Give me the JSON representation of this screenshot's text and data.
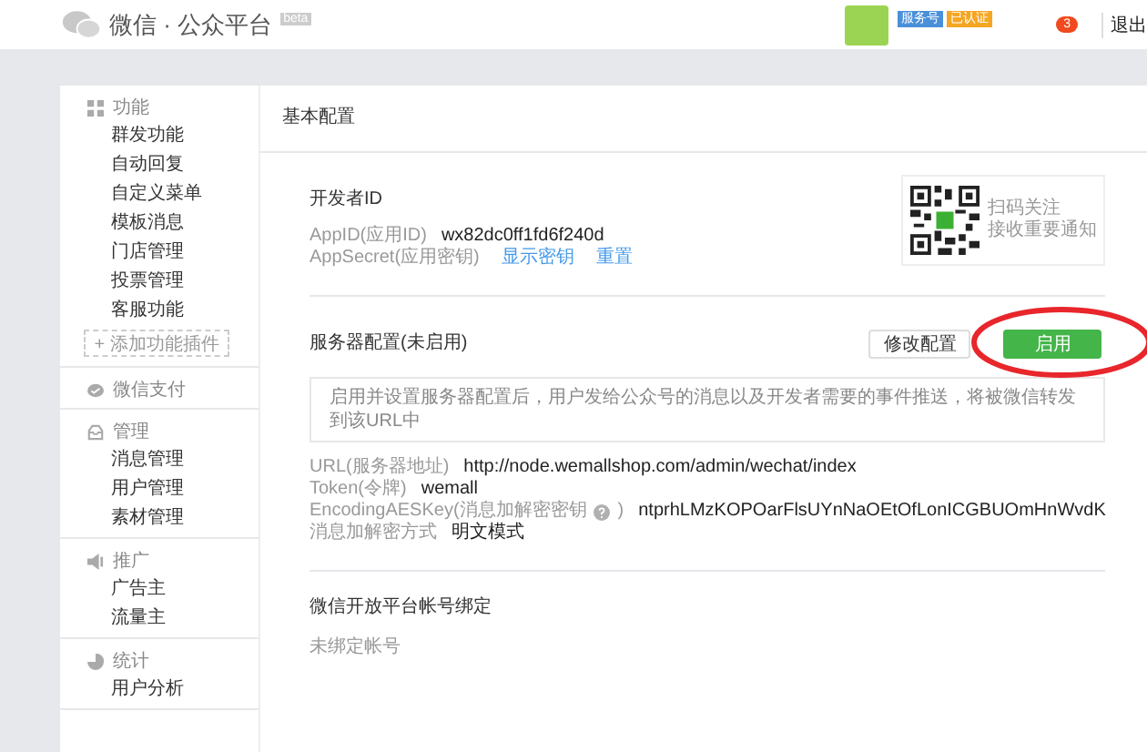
{
  "header": {
    "logo_text": "微信 · 公众平台",
    "beta": "beta",
    "account_badges": [
      {
        "text": "服务号",
        "color": "#4a90d9"
      },
      {
        "text": "已认证",
        "color": "#f5a623"
      }
    ],
    "notification_count": "3",
    "logout": "退出"
  },
  "sidebar": {
    "sections": [
      {
        "title": "功能",
        "items": [
          "群发功能",
          "自动回复",
          "自定义菜单",
          "模板消息",
          "门店管理",
          "投票管理",
          "客服功能"
        ],
        "add_button": "+ 添加功能插件"
      },
      {
        "title": "微信支付"
      },
      {
        "title": "管理",
        "items": [
          "消息管理",
          "用户管理",
          "素材管理"
        ]
      },
      {
        "title": "推广",
        "items": [
          "广告主",
          "流量主"
        ]
      },
      {
        "title": "统计",
        "items": [
          "用户分析"
        ]
      }
    ]
  },
  "main": {
    "title": "基本配置",
    "developer": {
      "heading": "开发者ID",
      "app_id_label": "AppID(应用ID)",
      "app_id": "wx82dc0ff1fd6f240d",
      "secret_label": "AppSecret(应用密钥)",
      "links": [
        "显示密钥",
        "重置"
      ]
    },
    "qr": {
      "lines": [
        "扫码关注",
        "接收重要通知"
      ]
    },
    "server": {
      "heading": "服务器配置(未启用)",
      "buttons": [
        {
          "label": "修改配置",
          "primary": false,
          "highlighted": false
        },
        {
          "label": "启用",
          "primary": true,
          "highlighted": true
        }
      ],
      "notice": "启用并设置服务器配置后，用户发给公众号的消息以及开发者需要的事件推送，将被微信转发到该URL中",
      "fields": [
        {
          "label": "URL(服务器地址)",
          "value": "http://node.wemallshop.com/admin/wechat/index",
          "help": false
        },
        {
          "label": "Token(令牌)",
          "value": "wemall",
          "help": false
        },
        {
          "label": "EncodingAESKey(消息加解密密钥",
          "label_suffix": ")",
          "value": "ntprhLMzKOPOarFlsUYnNaOEtOfLonICGBUOmHnWvdK",
          "help": true
        },
        {
          "label": "消息加解密方式",
          "value": "明文模式",
          "help": false
        }
      ]
    },
    "binding": {
      "heading": "微信开放平台帐号绑定",
      "text": "未绑定帐号"
    }
  }
}
